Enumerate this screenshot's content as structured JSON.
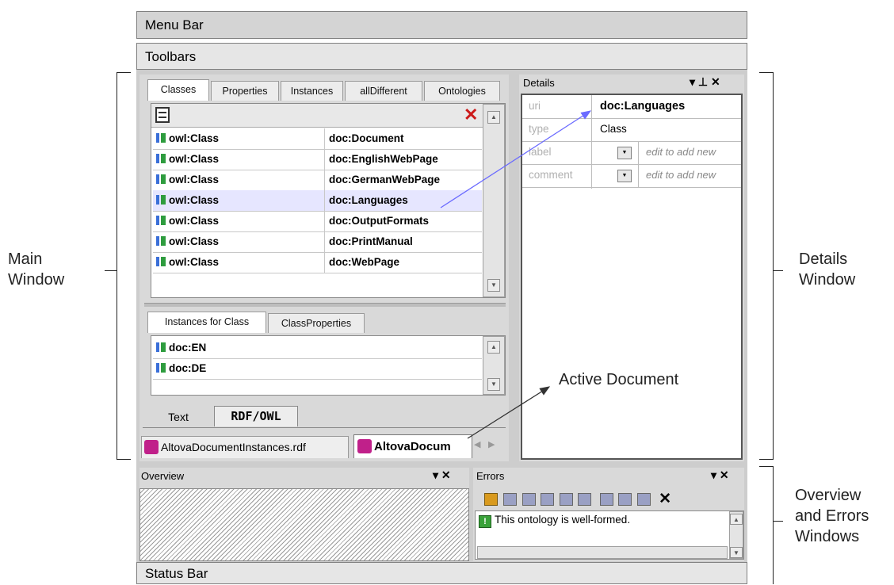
{
  "bars": {
    "menu": "Menu Bar",
    "toolbars": "Toolbars",
    "status": "Status Bar"
  },
  "annotations": {
    "main": [
      "Main",
      "Window"
    ],
    "details": [
      "Details",
      "Window"
    ],
    "overview_errors": [
      "Overview",
      "and Errors",
      "Windows"
    ],
    "active_document": "Active Document"
  },
  "main_tabs": [
    "Classes",
    "Properties",
    "Instances",
    "allDifferent",
    "Ontologies"
  ],
  "class_rows": [
    {
      "type": "owl:Class",
      "name": "doc:Document"
    },
    {
      "type": "owl:Class",
      "name": "doc:EnglishWebPage"
    },
    {
      "type": "owl:Class",
      "name": "doc:GermanWebPage"
    },
    {
      "type": "owl:Class",
      "name": "doc:Languages"
    },
    {
      "type": "owl:Class",
      "name": "doc:OutputFormats"
    },
    {
      "type": "owl:Class",
      "name": "doc:PrintManual"
    },
    {
      "type": "owl:Class",
      "name": "doc:WebPage"
    }
  ],
  "lower_tabs": [
    "Instances for Class",
    "ClassProperties"
  ],
  "instances": [
    "doc:EN",
    "doc:DE"
  ],
  "view_tabs": {
    "text": "Text",
    "rdf": "RDF/OWL"
  },
  "doc_tabs": [
    "AltovaDocumentInstances.rdf",
    "AltovaDocum"
  ],
  "details": {
    "title": "Details",
    "controls": "▾ ⊥ ✕",
    "rows": [
      {
        "key": "uri",
        "value": "doc:Languages"
      },
      {
        "key": "type",
        "value": "Class"
      },
      {
        "key": "label",
        "value": "edit to add new"
      },
      {
        "key": "comment",
        "value": "edit to add new"
      }
    ]
  },
  "overview": {
    "title": "Overview",
    "controls": "▾ ✕"
  },
  "errors": {
    "title": "Errors",
    "controls": "▾ ✕",
    "message": "This ontology is well-formed.",
    "status_glyph": "!"
  }
}
